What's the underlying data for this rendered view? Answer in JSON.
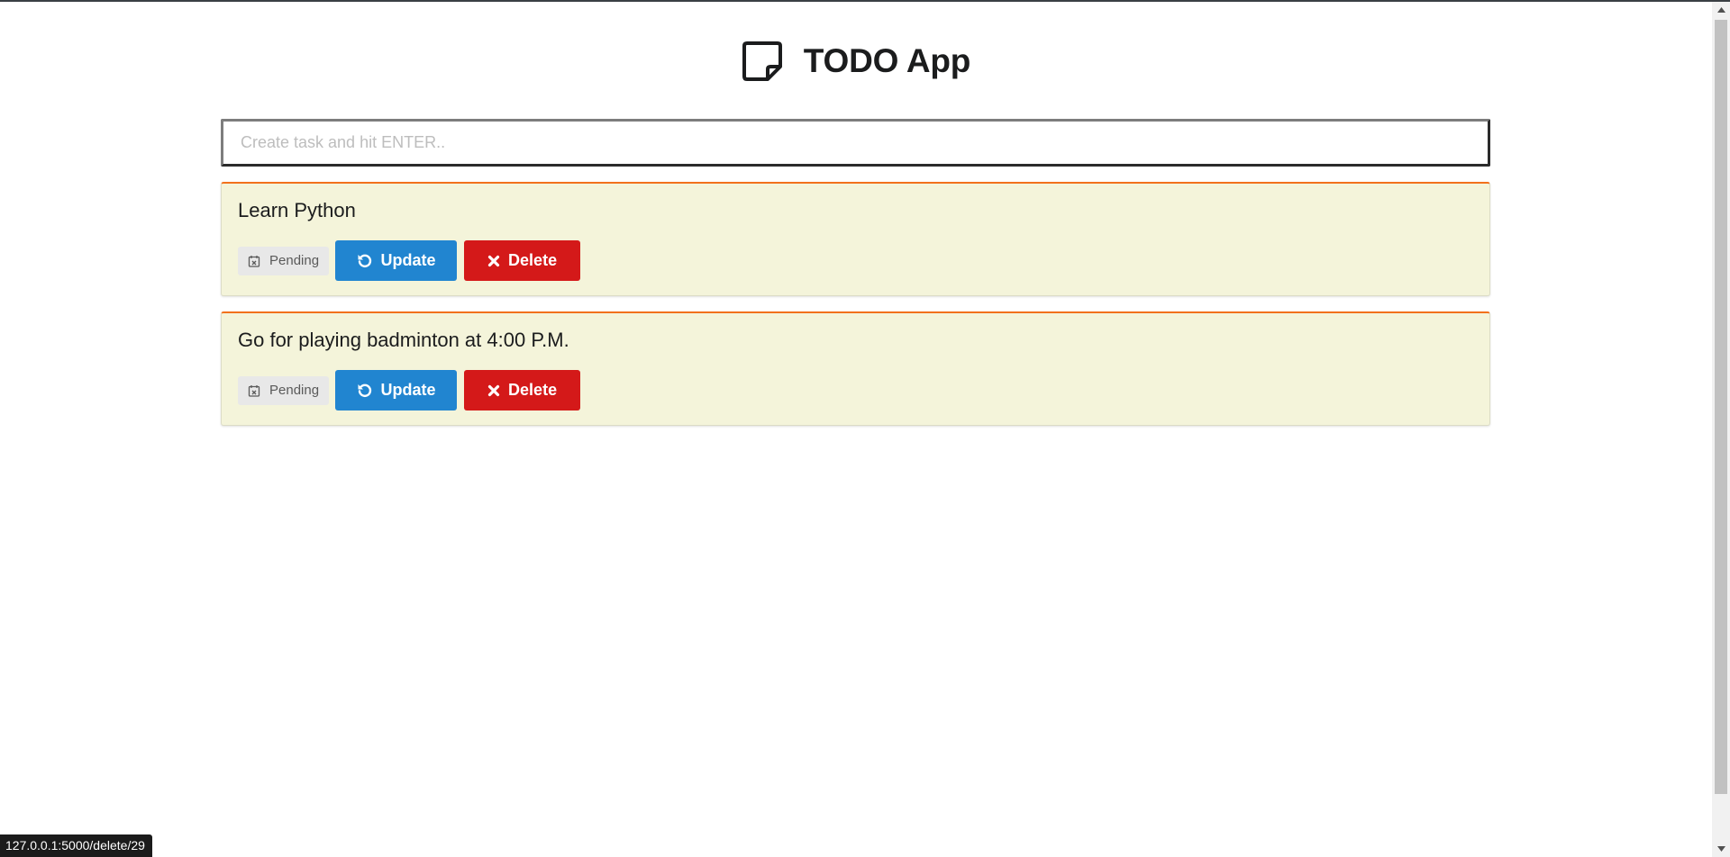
{
  "app": {
    "title": "TODO App",
    "icon": "sticky-note-icon"
  },
  "task_input": {
    "value": "",
    "placeholder": "Create task and hit ENTER.."
  },
  "tasks": [
    {
      "title": "Learn Python",
      "status": "Pending",
      "status_icon": "calendar-x-icon",
      "update_label": "Update",
      "delete_label": "Delete"
    },
    {
      "title": "Go for playing badminton at 4:00 P.M.",
      "status": "Pending",
      "status_icon": "calendar-x-icon",
      "update_label": "Update",
      "delete_label": "Delete"
    }
  ],
  "status_bar": {
    "url": "127.0.0.1:5000/delete/29"
  },
  "colors": {
    "accent_border": "#f2711c",
    "card_bg": "#f4f4da",
    "update_button": "#2185d0",
    "delete_button": "#d41919",
    "status_label_bg": "#e8e8e8"
  }
}
